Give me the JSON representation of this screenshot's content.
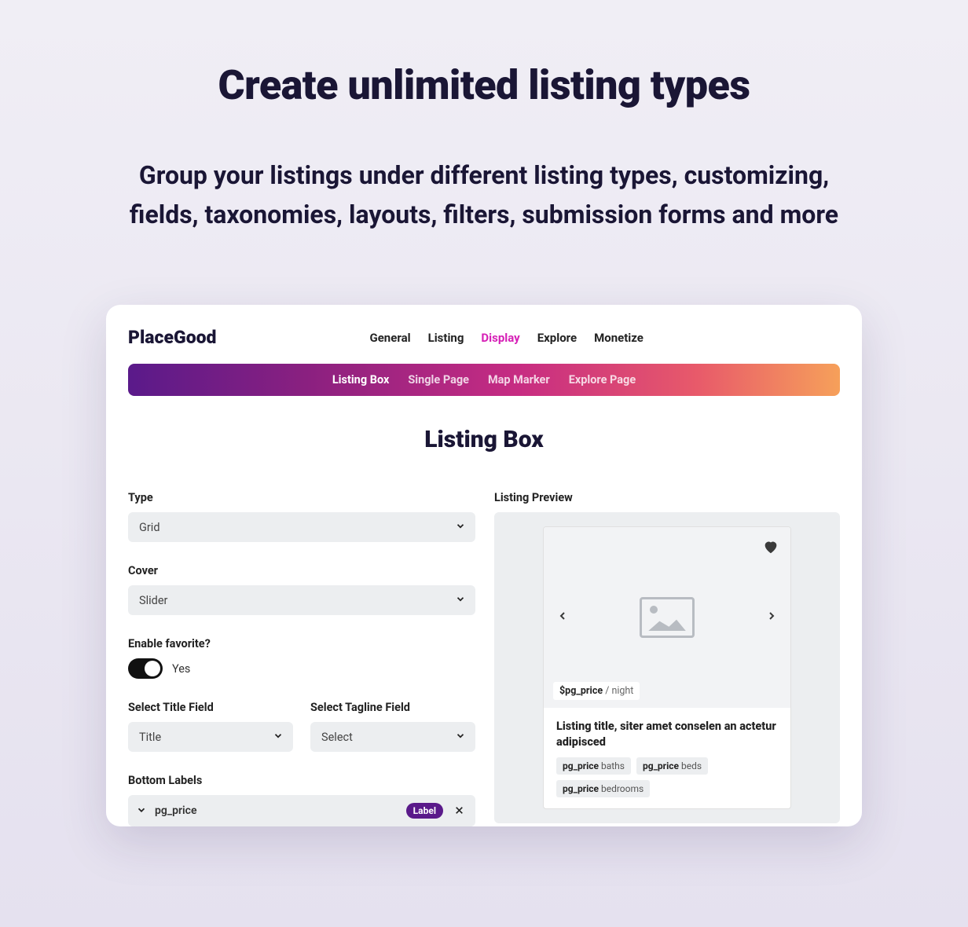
{
  "hero": {
    "title": "Create unlimited listing types",
    "subtitle": "Group your listings under different listing types, customizing, fields, taxonomies, layouts, filters, submission forms and more"
  },
  "brand": "PlaceGood",
  "top_nav": {
    "items": [
      "General",
      "Listing",
      "Display",
      "Explore",
      "Monetize"
    ],
    "active_index": 2
  },
  "sub_nav": {
    "items": [
      "Listing Box",
      "Single Page",
      "Map Marker",
      "Explore Page"
    ],
    "active_index": 0
  },
  "section_title": "Listing Box",
  "form": {
    "type_label": "Type",
    "type_value": "Grid",
    "cover_label": "Cover",
    "cover_value": "Slider",
    "favorite_label": "Enable favorite?",
    "favorite_value": "Yes",
    "title_field_label": "Select Title Field",
    "title_field_value": "Title",
    "tagline_field_label": "Select Tagline Field",
    "tagline_field_value": "Select",
    "bottom_labels_label": "Bottom Labels",
    "bottom_label_item": "pg_price",
    "bottom_label_badge": "Label"
  },
  "preview": {
    "heading": "Listing Preview",
    "price_var": "$pg_price",
    "price_suffix": " / night",
    "title": "Listing title, siter amet conselen an actetur adipisced",
    "chips": [
      {
        "var": "pg_price",
        "text": " baths"
      },
      {
        "var": "pg_price",
        "text": " beds"
      },
      {
        "var": "pg_price",
        "text": " bedrooms"
      }
    ]
  }
}
